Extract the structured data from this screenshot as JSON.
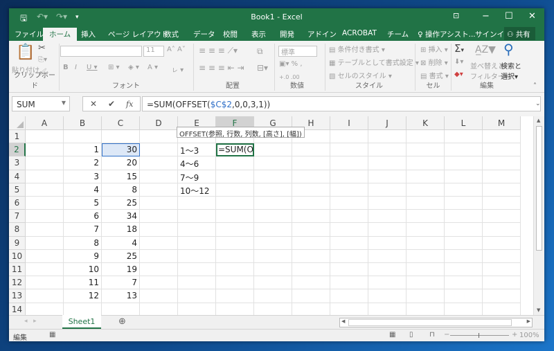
{
  "title": "Book1 - Excel",
  "tabs": [
    "ファイル",
    "ホーム",
    "挿入",
    "ページ レイアウト",
    "数式",
    "データ",
    "校閲",
    "表示",
    "開発",
    "アドイン",
    "ACROBAT",
    "チーム",
    "操作アシスト...",
    "サインイン",
    "共有"
  ],
  "active_tab": "ホーム",
  "ribbon": {
    "clipboard": {
      "paste": "貼り付け",
      "label": "クリップボード"
    },
    "font": {
      "size": "11",
      "label": "フォント"
    },
    "align": {
      "label": "配置"
    },
    "number": {
      "format": "標準",
      "label": "数値"
    },
    "styles": {
      "cond": "条件付き書式",
      "table": "テーブルとして書式設定",
      "cell": "セルのスタイル",
      "label": "スタイル"
    },
    "cells": {
      "insert": "挿入",
      "delete": "削除",
      "format": "書式",
      "label": "セル"
    },
    "editing": {
      "sort1": "並べ替えと",
      "sort2": "フィルター",
      "find1": "検索と",
      "find2": "選択",
      "label": "編集"
    }
  },
  "formula_bar": {
    "name_box": "SUM",
    "fx": "fx",
    "formula_pre": "=SUM(OFFSET(",
    "formula_ref": "$C$2",
    "formula_post": ",0,0,3,1))"
  },
  "tooltip": "OFFSET(参照, 行数, 列数, [高さ], [幅])",
  "columns": [
    "A",
    "B",
    "C",
    "D",
    "E",
    "F",
    "G",
    "H",
    "I",
    "J",
    "K",
    "L",
    "M"
  ],
  "rows": [
    {
      "r": "1"
    },
    {
      "r": "2",
      "B": "1",
      "C": "30",
      "E": "1〜3",
      "F": "=SUM(OF"
    },
    {
      "r": "3",
      "B": "2",
      "C": "20",
      "E": "4〜6"
    },
    {
      "r": "4",
      "B": "3",
      "C": "15",
      "E": "7〜9"
    },
    {
      "r": "5",
      "B": "4",
      "C": "8",
      "E": "10〜12"
    },
    {
      "r": "6",
      "B": "5",
      "C": "25"
    },
    {
      "r": "7",
      "B": "6",
      "C": "34"
    },
    {
      "r": "8",
      "B": "7",
      "C": "18"
    },
    {
      "r": "9",
      "B": "8",
      "C": "4"
    },
    {
      "r": "10",
      "B": "9",
      "C": "25"
    },
    {
      "r": "11",
      "B": "10",
      "C": "19"
    },
    {
      "r": "12",
      "B": "11",
      "C": "7"
    },
    {
      "r": "13",
      "B": "12",
      "C": "13"
    },
    {
      "r": "14"
    }
  ],
  "sheet_tab": "Sheet1",
  "status": {
    "mode": "編集",
    "zoom": "100%"
  },
  "colors": {
    "accent": "#217346",
    "ref": "#3070c8"
  }
}
